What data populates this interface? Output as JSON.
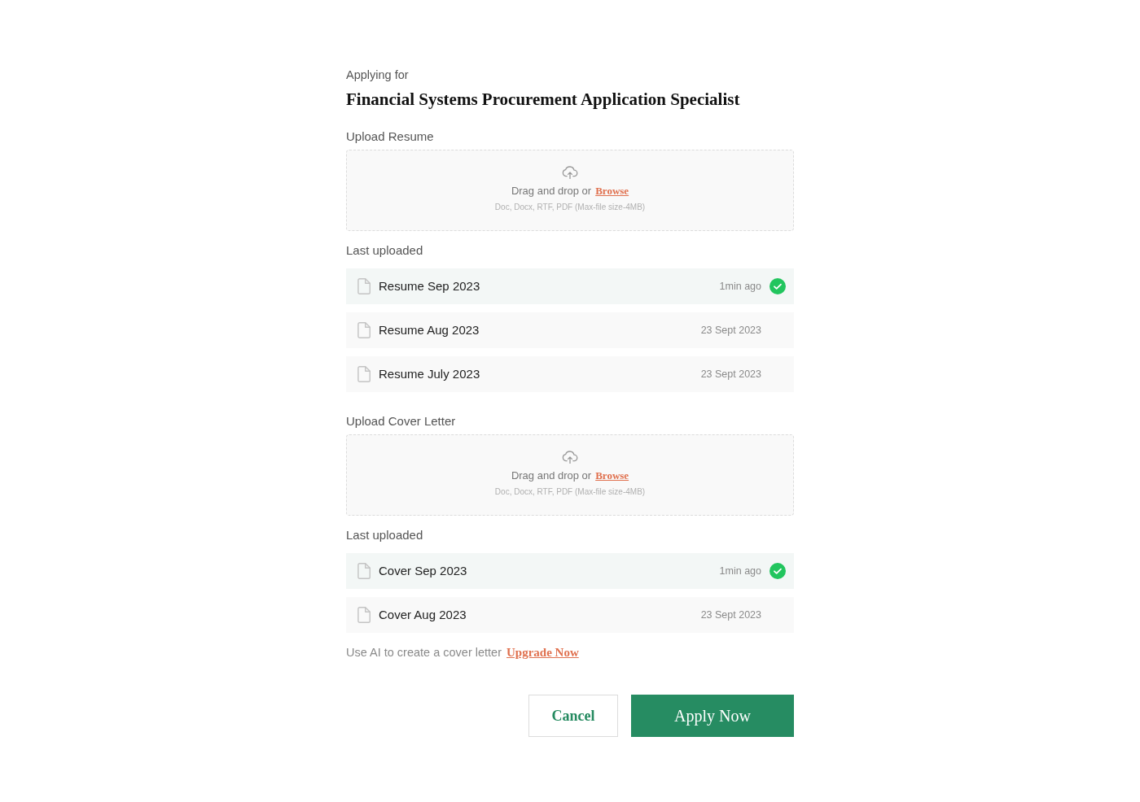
{
  "header": {
    "eyebrow": "Applying for",
    "title": "Financial Systems Procurement Application Specialist"
  },
  "sections": [
    {
      "label": "Upload Resume",
      "dropzone": {
        "prompt": "Drag and drop or",
        "link": "Browse",
        "hint": "Doc, Docx, RTF, PDF (Max-file size-4MB)"
      },
      "history_label": "Last uploaded",
      "files": [
        {
          "name": "Resume Sep 2023",
          "time": "1min ago",
          "selected": true
        },
        {
          "name": "Resume Aug 2023",
          "time": "23 Sept 2023",
          "selected": false
        },
        {
          "name": "Resume July 2023",
          "time": "23 Sept 2023",
          "selected": false
        }
      ]
    },
    {
      "label": "Upload Cover Letter",
      "dropzone": {
        "prompt": "Drag and drop or",
        "link": "Browse",
        "hint": "Doc, Docx, RTF, PDF (Max-file size-4MB)"
      },
      "history_label": "Last uploaded",
      "files": [
        {
          "name": "Cover Sep 2023",
          "time": "1min ago",
          "selected": true
        },
        {
          "name": "Cover Aug 2023",
          "time": "23 Sept 2023",
          "selected": false
        }
      ]
    }
  ],
  "ai_note": {
    "text": "Use AI to create a cover letter",
    "link": "Upgrade Now"
  },
  "buttons": [
    {
      "label": "Cancel",
      "kind": "secondary"
    },
    {
      "label": "Apply Now",
      "kind": "primary"
    }
  ]
}
